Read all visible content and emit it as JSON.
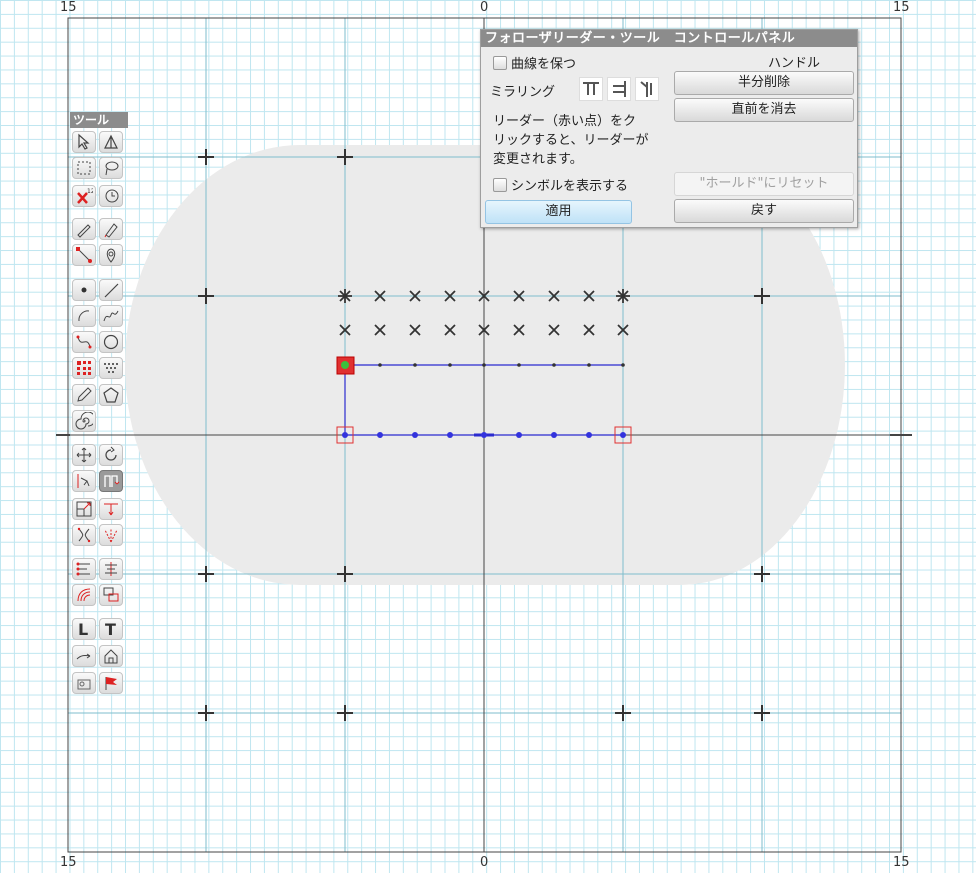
{
  "axis": {
    "top_left": "15",
    "top_center": "0",
    "top_right": "15",
    "bottom_left": "15",
    "bottom_center": "0",
    "bottom_right": "15"
  },
  "tool_panel": {
    "title": "ツール",
    "tools": [
      {
        "name": "select-arrow-icon",
        "active": false
      },
      {
        "name": "perspective-select-icon",
        "active": false
      },
      {
        "name": "rectangle-select-icon",
        "active": false
      },
      {
        "name": "lasso-select-icon",
        "active": false
      },
      {
        "name": "delete-x-icon",
        "active": false
      },
      {
        "name": "history-clock-icon",
        "active": false
      },
      {
        "name": "pen-icon",
        "active": false
      },
      {
        "name": "highlighter-icon",
        "active": false
      },
      {
        "name": "node-edit-icon",
        "active": false
      },
      {
        "name": "location-pin-icon",
        "active": false
      },
      {
        "name": "point-icon",
        "active": false
      },
      {
        "name": "line-icon",
        "active": false
      },
      {
        "name": "arc-icon",
        "active": false
      },
      {
        "name": "freehand-icon",
        "active": false
      },
      {
        "name": "bezier-icon",
        "active": false
      },
      {
        "name": "circle-icon",
        "active": false
      },
      {
        "name": "point-grid-icon",
        "active": false
      },
      {
        "name": "dot-array-icon",
        "active": false
      },
      {
        "name": "pencil-icon",
        "active": false
      },
      {
        "name": "polygon-icon",
        "active": false
      },
      {
        "name": "spiral-icon",
        "active": false
      },
      {
        "name": "move-icon",
        "active": false
      },
      {
        "name": "rotate-icon",
        "active": false
      },
      {
        "name": "reflect-icon",
        "active": false
      },
      {
        "name": "follower-leader-icon",
        "active": true
      },
      {
        "name": "scale-icon",
        "active": false
      },
      {
        "name": "translate-down-icon",
        "active": false
      },
      {
        "name": "pinch-icon",
        "active": false
      },
      {
        "name": "fan-icon",
        "active": false
      },
      {
        "name": "distribute-icon",
        "active": false
      },
      {
        "name": "align-icon",
        "active": false
      },
      {
        "name": "offset-icon",
        "active": false
      },
      {
        "name": "arrange-icon",
        "active": false
      },
      {
        "name": "label-l-icon",
        "active": false
      },
      {
        "name": "text-t-icon",
        "active": false
      },
      {
        "name": "connector-arrow-icon",
        "active": false
      },
      {
        "name": "home-icon",
        "active": false
      },
      {
        "name": "stamp-icon",
        "active": false
      },
      {
        "name": "flag-icon",
        "active": false
      }
    ],
    "labels": {
      "L": "L",
      "T": "T"
    }
  },
  "control_panel": {
    "title": "フォローザリーダー・ツール　コントロールパネル",
    "keep_curves_label": "曲線を保つ",
    "handle_label": "ハンドル",
    "mirroring_label": "ミラリング",
    "half_delete_button": "半分削除",
    "delete_last_button": "直前を消去",
    "instructions_line1": "リーダー（赤い点）をク",
    "instructions_line2": "リックすると、リーダーが",
    "instructions_line3": "変更されます。",
    "show_symbols_label": "シンボルを表示する",
    "reset_to_hold_button": "\"ホールド\"にリセット",
    "apply_button": "適用",
    "back_button": "戻す"
  },
  "colors": {
    "grid_minor": "#bfe6f0",
    "grid_major": "#7fbecc",
    "axis": "#444444",
    "shape_fill": "#ebebeb",
    "path_blue": "#2b2bcf",
    "leader_red": "#e03030",
    "handle_green": "#3cc03c"
  }
}
